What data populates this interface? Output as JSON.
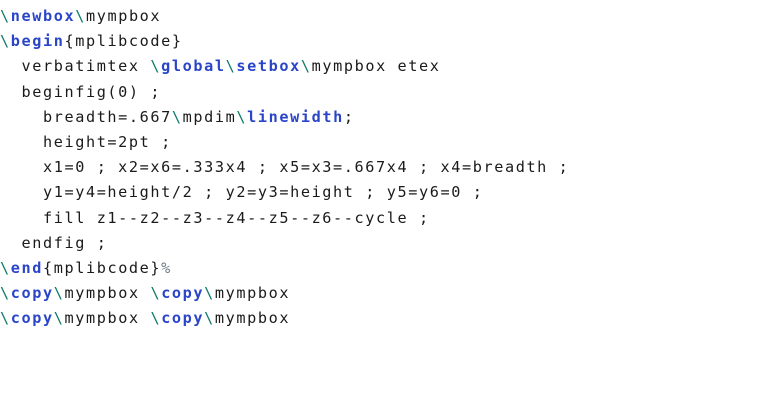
{
  "colors": {
    "plain": "#1a1a1a",
    "backslash": "#0c7a68",
    "keyword": "#2a45c8",
    "comment": "#6e7c8a"
  },
  "lines": [
    [
      [
        "bs",
        "\\"
      ],
      [
        "kw",
        "newbox"
      ],
      [
        "bs",
        "\\"
      ],
      [
        "plain",
        "mympbox"
      ]
    ],
    [
      [
        "bs",
        "\\"
      ],
      [
        "kw",
        "begin"
      ],
      [
        "plain",
        "{mplibcode}"
      ]
    ],
    [
      [
        "plain",
        "  verbatimtex "
      ],
      [
        "bs",
        "\\"
      ],
      [
        "kw",
        "global"
      ],
      [
        "bs",
        "\\"
      ],
      [
        "kw",
        "setbox"
      ],
      [
        "bs",
        "\\"
      ],
      [
        "plain",
        "mympbox etex"
      ]
    ],
    [
      [
        "plain",
        "  beginfig(0) ;"
      ]
    ],
    [
      [
        "plain",
        "    breadth=.667"
      ],
      [
        "bs",
        "\\"
      ],
      [
        "plain",
        "mpdim"
      ],
      [
        "bs",
        "\\"
      ],
      [
        "kw",
        "linewidth"
      ],
      [
        "plain",
        ";"
      ]
    ],
    [
      [
        "plain",
        "    height=2pt ;"
      ]
    ],
    [
      [
        "plain",
        "    x1=0 ; x2=x6=.333x4 ; x5=x3=.667x4 ; x4=breadth ;"
      ]
    ],
    [
      [
        "plain",
        "    y1=y4=height/2 ; y2=y3=height ; y5=y6=0 ;"
      ]
    ],
    [
      [
        "plain",
        "    fill z1--z2--z3--z4--z5--z6--cycle ;"
      ]
    ],
    [
      [
        "plain",
        "  endfig ;"
      ]
    ],
    [
      [
        "bs",
        "\\"
      ],
      [
        "kw",
        "end"
      ],
      [
        "plain",
        "{mplibcode}"
      ],
      [
        "pct",
        "%"
      ]
    ],
    [
      [
        "bs",
        "\\"
      ],
      [
        "kw",
        "copy"
      ],
      [
        "bs",
        "\\"
      ],
      [
        "plain",
        "mympbox "
      ],
      [
        "bs",
        "\\"
      ],
      [
        "kw",
        "copy"
      ],
      [
        "bs",
        "\\"
      ],
      [
        "plain",
        "mympbox"
      ]
    ],
    [
      [
        "bs",
        "\\"
      ],
      [
        "kw",
        "copy"
      ],
      [
        "bs",
        "\\"
      ],
      [
        "plain",
        "mympbox "
      ],
      [
        "bs",
        "\\"
      ],
      [
        "kw",
        "copy"
      ],
      [
        "bs",
        "\\"
      ],
      [
        "plain",
        "mympbox"
      ]
    ]
  ]
}
